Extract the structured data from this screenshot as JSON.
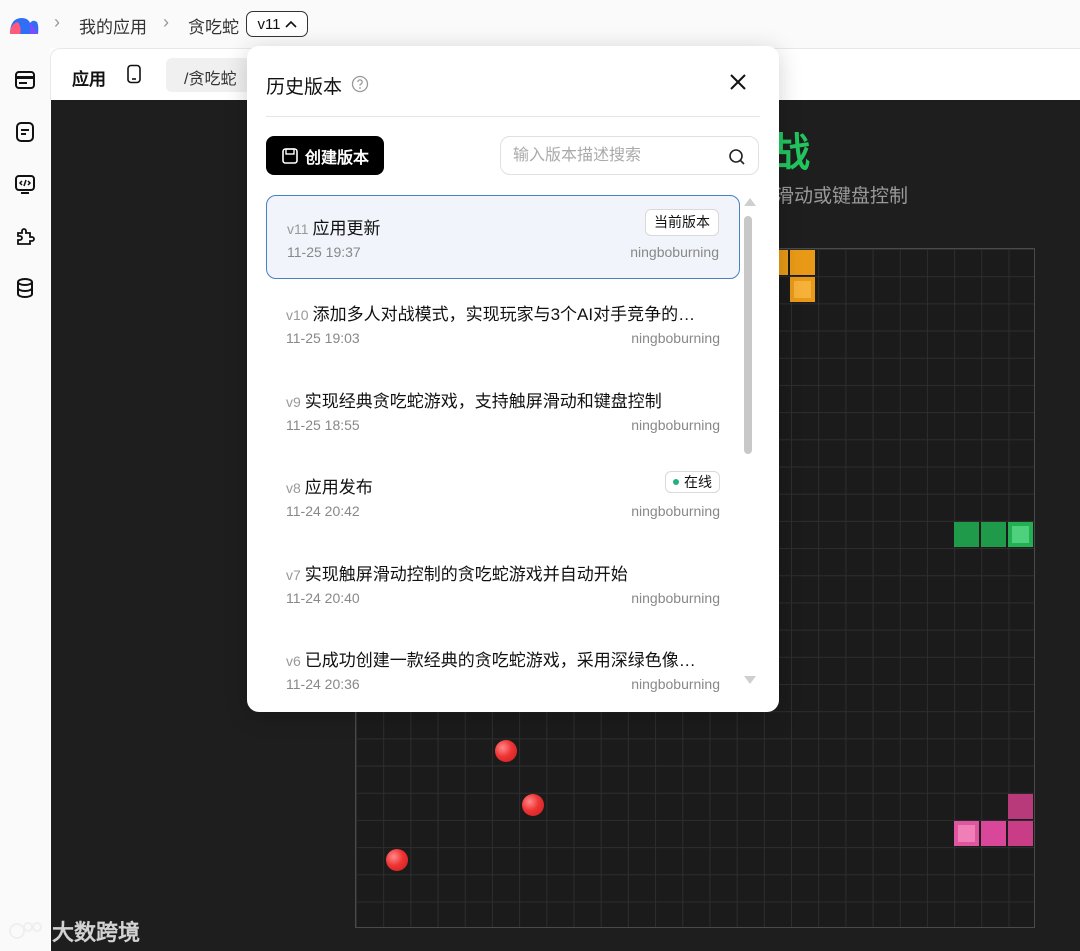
{
  "breadcrumb": {
    "items": [
      "我的应用",
      "贪吃蛇"
    ],
    "version_pill": "v11"
  },
  "tabbar": {
    "app_label": "应用",
    "path": "/贪吃蛇"
  },
  "rail": {
    "icons": [
      "layers-icon",
      "document-icon",
      "code-icon",
      "puzzle-icon",
      "database-icon"
    ]
  },
  "game": {
    "title_fragment": "战",
    "subtitle_fragment": "滑动或键盘控制"
  },
  "history": {
    "title": "历史版本",
    "create_label": "创建版本",
    "search_placeholder": "输入版本描述搜索",
    "current_badge": "当前版本",
    "online_badge": "在线",
    "versions": [
      {
        "ver": "v11",
        "title": "应用更新",
        "time": "11-25 19:37",
        "user": "ningboburning"
      },
      {
        "ver": "v10",
        "title": "添加多人对战模式，实现玩家与3个AI对手竞争的贪...",
        "time": "11-25 19:03",
        "user": "ningboburning"
      },
      {
        "ver": "v9",
        "title": "实现经典贪吃蛇游戏，支持触屏滑动和键盘控制",
        "time": "11-25 18:55",
        "user": "ningboburning"
      },
      {
        "ver": "v8",
        "title": "应用发布",
        "time": "11-24 20:42",
        "user": "ningboburning"
      },
      {
        "ver": "v7",
        "title": "实现触屏滑动控制的贪吃蛇游戏并自动开始",
        "time": "11-24 20:40",
        "user": "ningboburning"
      },
      {
        "ver": "v6",
        "title": "已成功创建一款经典的贪吃蛇游戏，采用深绿色像素...",
        "time": "11-24 20:36",
        "user": "ningboburning"
      }
    ]
  },
  "watermark": "大数跨境",
  "colors": {
    "snake_green": "#22c55e",
    "snake_orange": "#f59e0b",
    "snake_pink": "#db2777",
    "food_red": "#ef3333",
    "active_border": "#4a7fc1"
  }
}
